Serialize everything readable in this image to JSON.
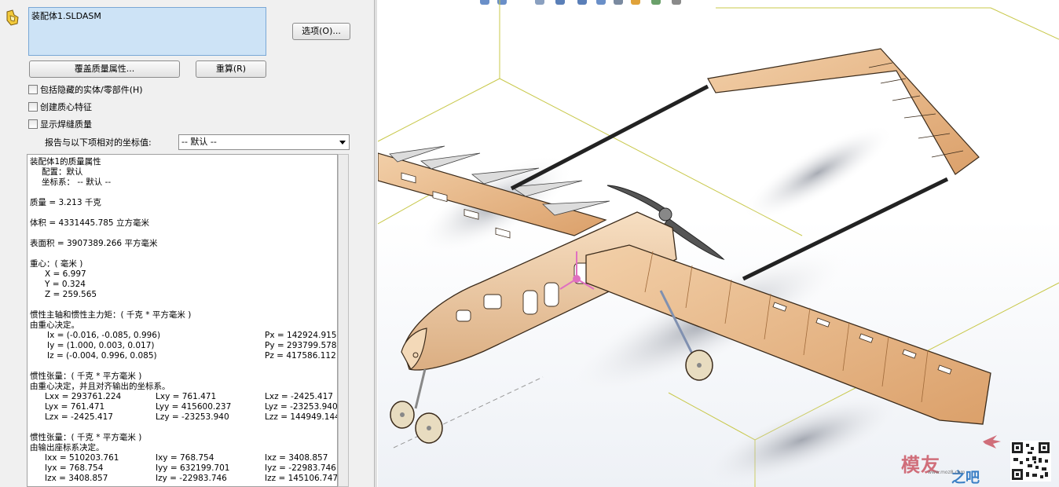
{
  "panel": {
    "selected_component": "装配体1.SLDASM",
    "options_label": "选项(O)...",
    "override_label": "覆盖质量属性...",
    "recalc_label": "重算(R)",
    "checkboxes": [
      {
        "label": "包括隐藏的实体/零部件(H)",
        "checked": false
      },
      {
        "label": "创建质心特征",
        "checked": false
      },
      {
        "label": "显示焊缝质量",
        "checked": false
      }
    ],
    "coord_label": "报告与以下项相对的坐标值:",
    "coord_value": "-- 默认 --"
  },
  "results": {
    "title": "装配体1的质量属性",
    "config": "配置：默认",
    "coord_sys": "坐标系： -- 默认 --",
    "mass": "质量 = 3.213 千克",
    "volume": "体积 = 4331445.785 立方毫米",
    "area": "表面积 = 3907389.266 平方毫米",
    "com_title": "重心：( 毫米 )",
    "com_x": "X = 6.997",
    "com_y": "Y = 0.324",
    "com_z": "Z = 259.565",
    "principal_title": "惯性主轴和惯性主力矩：( 千克 * 平方毫米 )",
    "principal_sub": "由重心决定。",
    "ix": "Ix = (-0.016, -0.085, 0.996)",
    "iy": "Iy = (1.000, 0.003, 0.017)",
    "iz": "Iz = (-0.004, 0.996, 0.085)",
    "px": "Px = 142924.915",
    "py": "Py = 293799.578",
    "pz": "Pz = 417586.112",
    "tensor1_title": "惯性张量：( 千克 * 平方毫米 )",
    "tensor1_sub": "由重心决定，并且对齐输出的坐标系。",
    "lxx": "Lxx = 293761.224",
    "lxy": "Lxy = 761.471",
    "lxz": "Lxz = -2425.417",
    "lyx": "Lyx = 761.471",
    "lyy": "Lyy = 415600.237",
    "lyz": "Lyz = -23253.940",
    "lzx": "Lzx = -2425.417",
    "lzy": "Lzy = -23253.940",
    "lzz": "Lzz = 144949.144",
    "tensor2_title": "惯性张量：( 千克 * 平方毫米 )",
    "tensor2_sub": "由输出座标系决定。",
    "ixx": "Ixx = 510203.761",
    "ixy": "Ixy = 768.754",
    "ixz": "Ixz = 3408.857",
    "iyx": "Iyx = 768.754",
    "iyy": "Iyy = 632199.701",
    "iyz": "Iyz = -22983.746",
    "izx": "Izx = 3408.857",
    "izy": "Izy = -22983.746",
    "izz": "Izz = 145106.747"
  },
  "watermark": {
    "brand": "模友",
    "brand2": "之吧",
    "url": "www.moz8.com"
  },
  "colors": {
    "wood": "#e9b98a",
    "wood_dark": "#b87a45",
    "bay": "#d8d8d8",
    "outline": "#3a2a1a",
    "selection": "#cde3f6",
    "bbox": "#c8c84a"
  }
}
